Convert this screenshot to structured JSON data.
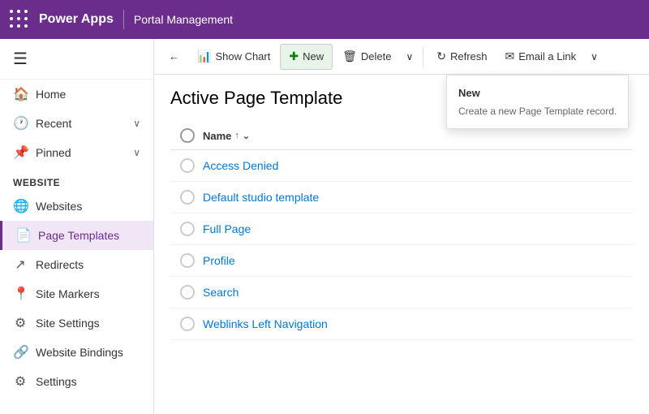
{
  "topbar": {
    "app_name": "Power Apps",
    "subtitle": "Portal Management"
  },
  "sidebar": {
    "menu_button_label": "≡",
    "items": [
      {
        "id": "home",
        "label": "Home",
        "icon": "🏠",
        "has_chevron": false
      },
      {
        "id": "recent",
        "label": "Recent",
        "icon": "🕐",
        "has_chevron": true
      },
      {
        "id": "pinned",
        "label": "Pinned",
        "icon": "📌",
        "has_chevron": true
      }
    ],
    "section_label": "Website",
    "sub_items": [
      {
        "id": "websites",
        "label": "Websites",
        "icon": "🌐",
        "active": false
      },
      {
        "id": "page-templates",
        "label": "Page Templates",
        "icon": "📄",
        "active": true
      },
      {
        "id": "redirects",
        "label": "Redirects",
        "icon": "↗",
        "active": false
      },
      {
        "id": "site-markers",
        "label": "Site Markers",
        "icon": "📍",
        "active": false
      },
      {
        "id": "site-settings",
        "label": "Site Settings",
        "icon": "⚙",
        "active": false
      },
      {
        "id": "website-bindings",
        "label": "Website Bindings",
        "icon": "🔗",
        "active": false
      },
      {
        "id": "settings",
        "label": "Settings",
        "icon": "⚙",
        "active": false
      }
    ]
  },
  "toolbar": {
    "back_label": "←",
    "show_chart_label": "Show Chart",
    "new_label": "New",
    "delete_label": "Delete",
    "refresh_label": "Refresh",
    "email_link_label": "Email a Link"
  },
  "main": {
    "page_title": "Active Page Template",
    "table": {
      "col_name": "Name",
      "sort_indicator": "↑",
      "rows": [
        {
          "label": "Access Denied"
        },
        {
          "label": "Default studio template"
        },
        {
          "label": "Full Page"
        },
        {
          "label": "Profile"
        },
        {
          "label": "Search"
        },
        {
          "label": "Weblinks Left Navigation"
        }
      ]
    }
  },
  "tooltip": {
    "title": "New",
    "description": "Create a new Page Template record."
  }
}
